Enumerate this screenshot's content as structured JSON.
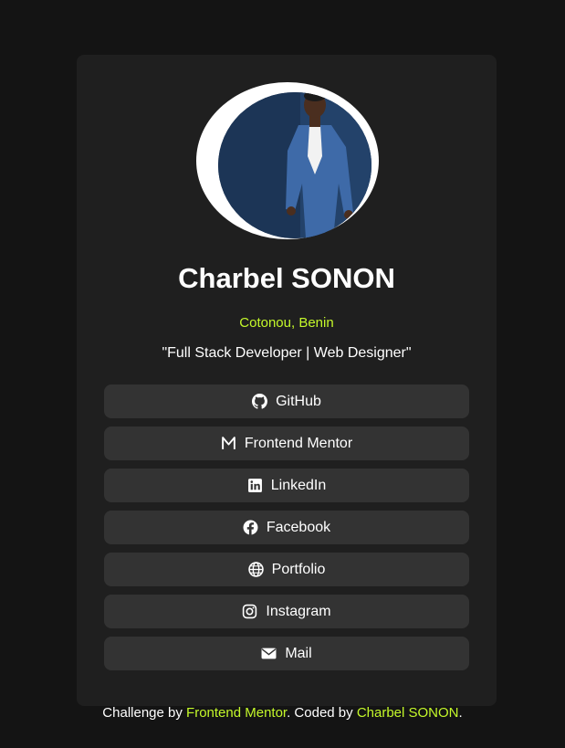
{
  "profile": {
    "name": "Charbel SONON",
    "location": "Cotonou, Benin",
    "bio": "\"Full Stack Developer | Web Designer\""
  },
  "links": [
    {
      "label": "GitHub",
      "icon": "github-icon"
    },
    {
      "label": "Frontend Mentor",
      "icon": "frontend-mentor-icon"
    },
    {
      "label": "LinkedIn",
      "icon": "linkedin-icon"
    },
    {
      "label": "Facebook",
      "icon": "facebook-icon"
    },
    {
      "label": "Portfolio",
      "icon": "globe-icon"
    },
    {
      "label": "Instagram",
      "icon": "instagram-icon"
    },
    {
      "label": "Mail",
      "icon": "envelope-icon"
    }
  ],
  "footer": {
    "prefix": "Challenge by ",
    "challenge_link": "Frontend Mentor",
    "middle": ". Coded by ",
    "author_link": "Charbel SONON",
    "suffix": "."
  },
  "colors": {
    "background": "#141414",
    "card": "#1f1f1f",
    "button": "#333333",
    "accent": "#c4f82a",
    "text": "#ffffff"
  }
}
